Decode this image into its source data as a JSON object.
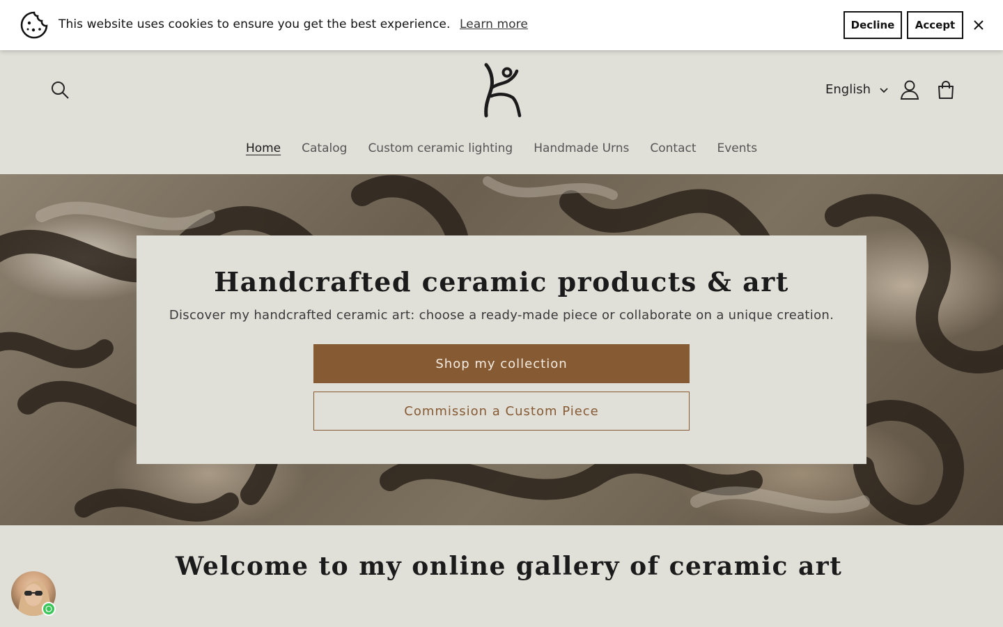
{
  "cookie_banner": {
    "message": "This website uses cookies to ensure you get the best experience.",
    "learn_more": "Learn more",
    "decline": "Decline",
    "accept": "Accept"
  },
  "header": {
    "language": "English",
    "nav": [
      {
        "label": "Home",
        "active": true
      },
      {
        "label": "Catalog"
      },
      {
        "label": "Custom ceramic lighting"
      },
      {
        "label": "Handmade Urns"
      },
      {
        "label": "Contact"
      },
      {
        "label": "Events"
      }
    ]
  },
  "hero": {
    "title": "Handcrafted ceramic products & art",
    "subtitle": "Discover my handcrafted ceramic art: choose a ready-made piece or collaborate on a unique creation.",
    "primary_cta": "Shop my collection",
    "secondary_cta": "Commission a Custom Piece"
  },
  "welcome": {
    "title": "Welcome to my online gallery of ceramic art"
  },
  "colors": {
    "accent": "#865a33",
    "background": "#e0dfd8",
    "chat_status": "#3cc55a"
  },
  "icons": [
    "cookie-icon",
    "close-icon",
    "search-icon",
    "logo-figure-icon",
    "chevron-down-icon",
    "account-icon",
    "cart-icon",
    "whatsapp-icon"
  ]
}
